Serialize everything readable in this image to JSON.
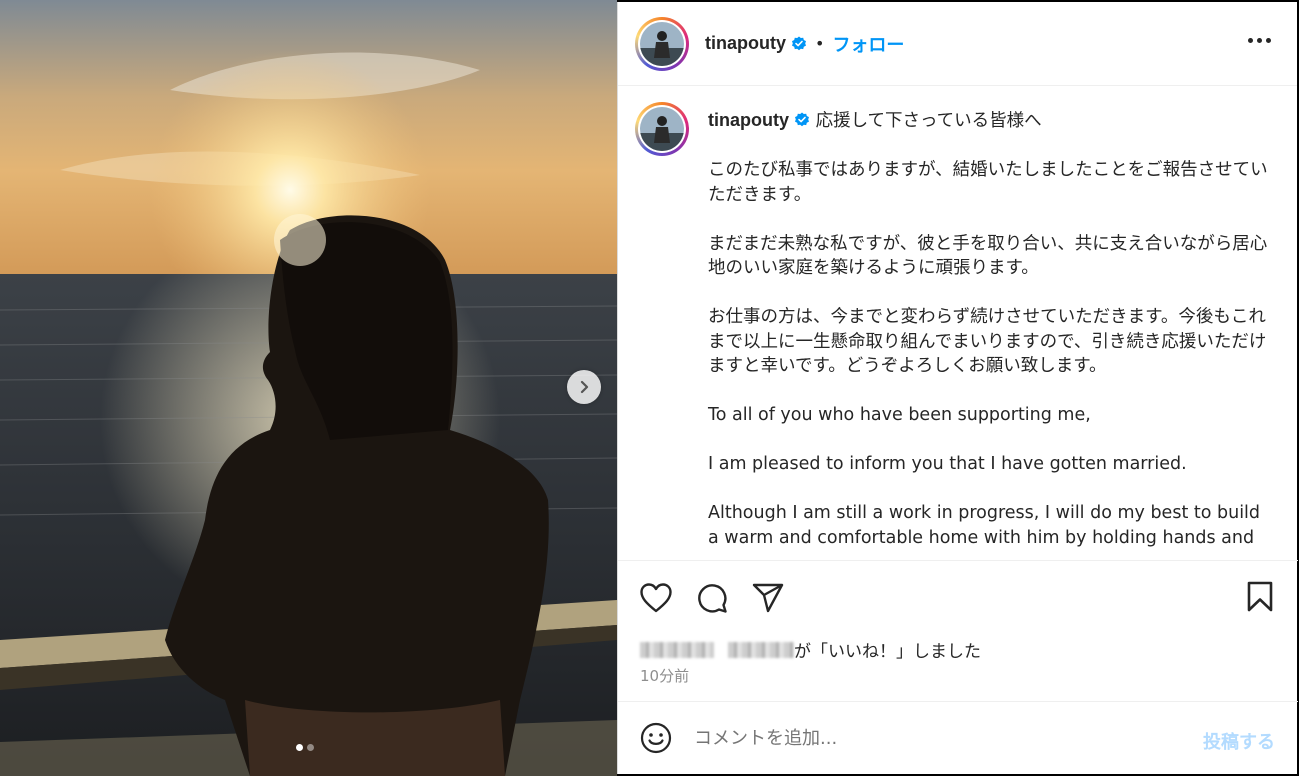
{
  "media": {
    "top_text": "",
    "dots": [
      true,
      false
    ],
    "next_icon": "chevron-right-icon"
  },
  "post": {
    "username": "tinapouty",
    "follow_label": "フォロー",
    "separator": "•",
    "more_icon": "more-horizontal-icon"
  },
  "caption": {
    "username": "tinapouty",
    "title": "応援して下さっている皆様へ",
    "paragraphs": [
      "このたび私事ではありますが、結婚いたしましたことをご報告させていただきます。",
      "まだまだ未熟な私ですが、彼と手を取り合い、共に支え合いながら居心地のいい家庭を築けるように頑張ります。",
      "お仕事の方は、今までと変わらず続けさせていただきます。今後もこれまで以上に一生懸命取り組んでまいりますので、引き続き応援いただけますと幸いです。どうぞよろしくお願い致します。",
      "To all of you who have been supporting me,",
      "I am pleased to inform you that I have gotten married.",
      "Although I am still a work in progress, I will do my best to build a warm and comfortable home with him by holding hands and"
    ]
  },
  "actions": {
    "like_icon": "heart-icon",
    "comment_icon": "comment-icon",
    "share_icon": "send-icon",
    "save_icon": "bookmark-icon",
    "liked_by_suffix": "が「いいね！」しました",
    "time_ago": "10分前"
  },
  "comment": {
    "emoji_icon": "smiley-icon",
    "placeholder": "コメントを追加...",
    "post_label": "投稿する"
  },
  "colors": {
    "accent": "#0095f6",
    "post_disabled": "#b3dbff",
    "muted": "#8e8e8e"
  }
}
